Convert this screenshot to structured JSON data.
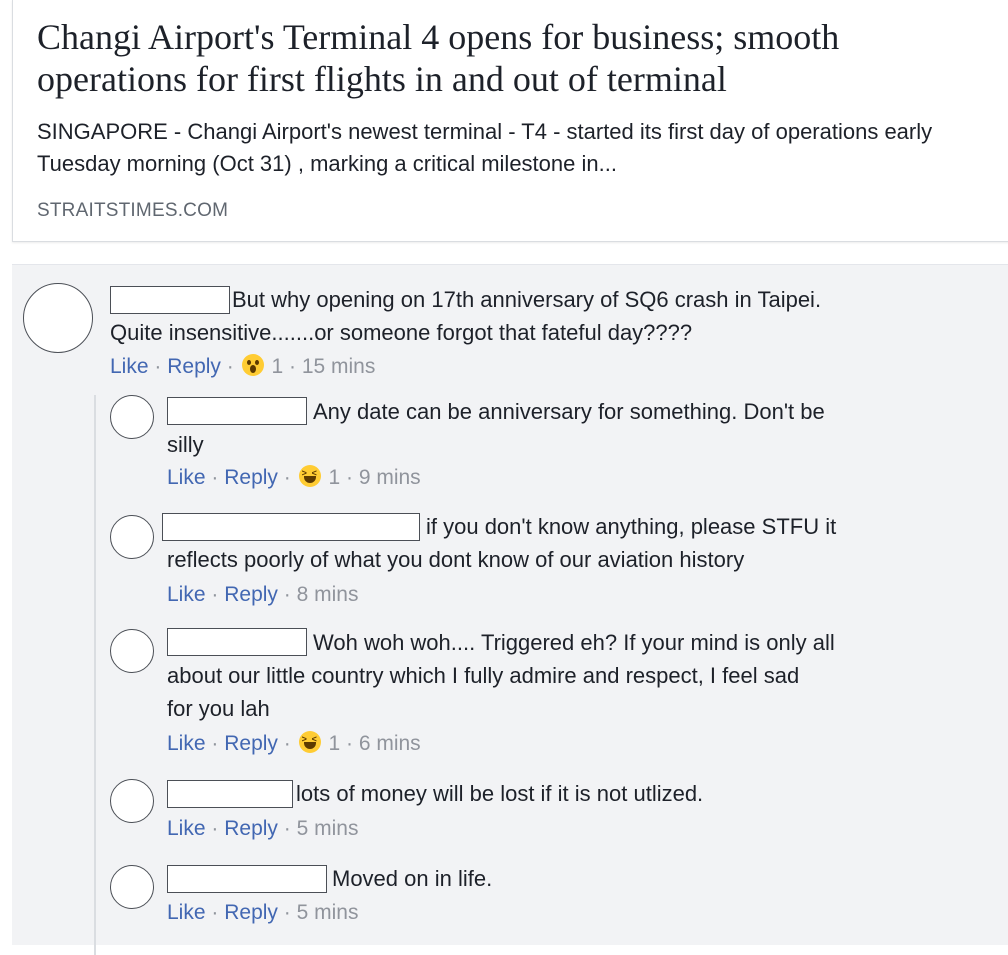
{
  "link_card": {
    "title": "Changi Airport's Terminal 4 opens for business; smooth operations for first flights in and out of terminal",
    "description": "SINGAPORE - Changi Airport's newest terminal - T4 - started its first day of operations early Tuesday morning (Oct 31) , marking a critical milestone in...",
    "domain": "STRAITSTIMES.COM"
  },
  "actions": {
    "like": "Like",
    "reply": "Reply",
    "sep": "·"
  },
  "comments": [
    {
      "text": "But why opening on 17th anniversary of SQ6 crash in Taipei.",
      "text2": "Quite insensitive.......or someone forgot that fateful day????",
      "reaction_icon": "surprised-emoji",
      "reaction_count": "1",
      "time": "15 mins"
    },
    {
      "text": "Any date can be anniversary for something. Don't be",
      "text2": "silly",
      "reaction_icon": "laughing-emoji",
      "reaction_count": "1",
      "time": "9 mins"
    },
    {
      "text": "if you don't know anything, please STFU it",
      "text2": "reflects poorly of what you dont know of our aviation history",
      "time": "8 mins"
    },
    {
      "text": "Woh woh woh.... Triggered eh? If your mind is only all",
      "text2": "about our little country which I fully admire and respect, I feel sad",
      "text3": "for you lah",
      "reaction_icon": "laughing-emoji",
      "reaction_count": "1",
      "time": "6 mins"
    },
    {
      "text": "lots of money will be lost if it is not utlized.",
      "time": "5 mins"
    },
    {
      "text": "Moved on in life.",
      "time": "5 mins"
    }
  ]
}
